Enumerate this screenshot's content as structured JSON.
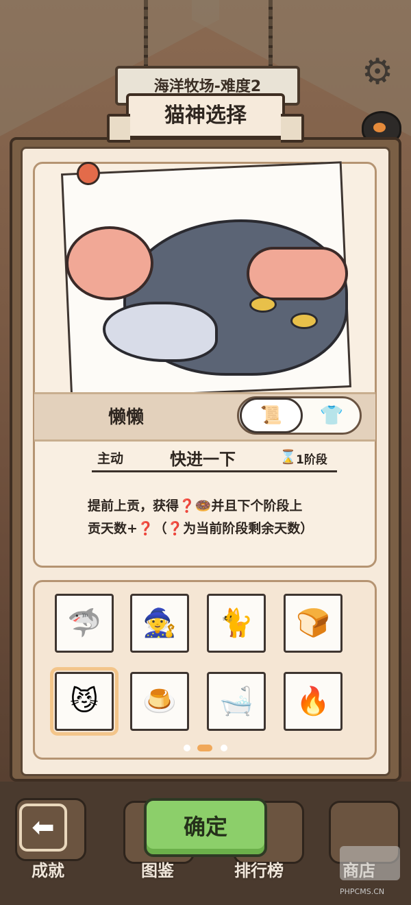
{
  "level_sign": "海洋牧场-难度2",
  "title": "猫神选择",
  "selected_cat": {
    "name": "懒懒",
    "skill_type": "主动",
    "skill_name": "快进一下",
    "stage": "1阶段",
    "description_line1": "提前上贡，获得❓🍩并且下个阶段上",
    "description_line2": "贡天数+❓（❓为当前阶段剩余天数）"
  },
  "toggle": {
    "left_icon": "certificate-icon",
    "right_icon": "shirt-icon"
  },
  "grid": [
    {
      "icon": "shark-cat-icon",
      "emoji": "🦈"
    },
    {
      "icon": "wizard-cat-icon",
      "emoji": "🧙"
    },
    {
      "icon": "siamese-cat-icon",
      "emoji": "🐈"
    },
    {
      "icon": "bread-cat-icon",
      "emoji": "🍞"
    },
    {
      "icon": "lazy-cat-icon",
      "emoji": "😼",
      "selected": true
    },
    {
      "icon": "pudding-cat-icon",
      "emoji": "🍮"
    },
    {
      "icon": "bath-cat-icon",
      "emoji": "🛁"
    },
    {
      "icon": "fire-cat-icon",
      "emoji": "🔥"
    }
  ],
  "page_dots": {
    "count": 3,
    "active": 1
  },
  "bottom_nav": {
    "achievements": "成就",
    "catalog": "图鉴",
    "leaderboard": "排行榜",
    "shop": "商店"
  },
  "confirm_label": "确定",
  "watermark": "PHPCMS.CN"
}
